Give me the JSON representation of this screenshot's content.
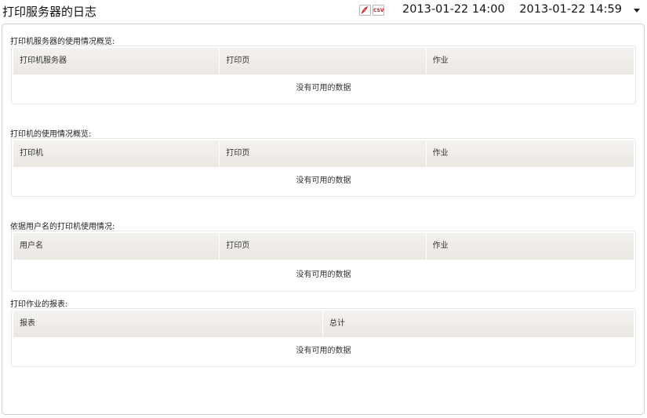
{
  "header": {
    "title": "打印服务器的日志",
    "export_pdf_icon": "pdf-icon",
    "export_csv_icon": "csv-icon",
    "export_csv_label": "CSV",
    "start_datetime": "2013-01-22 14:00",
    "end_datetime": "2013-01-22 14:59"
  },
  "sections": [
    {
      "title": "打印机服务器的使用情况概览:",
      "columns": [
        "打印机服务器",
        "打印页",
        "作业"
      ],
      "empty_text": "没有可用的数据"
    },
    {
      "title": "打印机的使用情况概览:",
      "columns": [
        "打印机",
        "打印页",
        "作业"
      ],
      "empty_text": "没有可用的数据"
    },
    {
      "title": "依据用户名的打印机使用情况:",
      "columns": [
        "用户名",
        "打印页",
        "作业"
      ],
      "empty_text": "没有可用的数据"
    },
    {
      "title": "打印作业的报表:",
      "columns": [
        "报表",
        "总计"
      ],
      "empty_text": "没有可用的数据"
    }
  ]
}
